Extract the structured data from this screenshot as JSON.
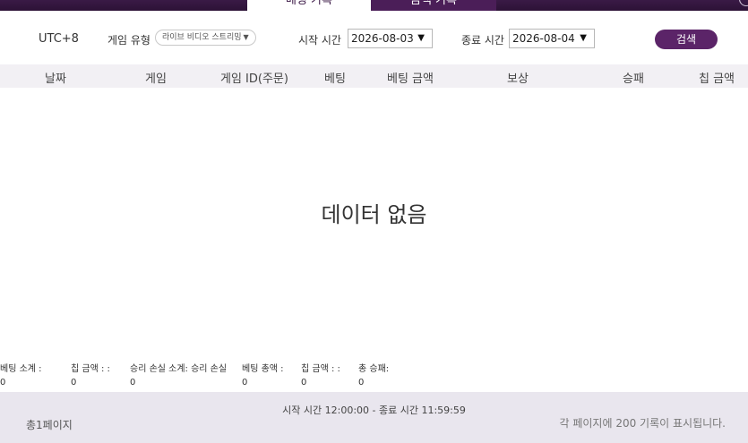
{
  "tabs": [
    {
      "label": "베팅 기록"
    },
    {
      "label": "금액 기록"
    }
  ],
  "filters": {
    "timezone": "UTC+8",
    "game_type_label": "게임 유형",
    "game_type_value": "라이브 비디오 스트리밍",
    "start_label": "시작 시간",
    "start_value": "2026-08-03",
    "end_label": "종료 시간",
    "end_value": "2026-08-04",
    "search_label": "검색"
  },
  "table": {
    "columns": [
      "날짜",
      "게임",
      "게임 ID(주문)",
      "베팅",
      "베팅 금액",
      "보상",
      "승패",
      "칩 금액"
    ],
    "empty_text": "데이터 없음"
  },
  "summary": [
    {
      "label": "베팅 소계 :",
      "value": "0"
    },
    {
      "label": "칩 금액 : :",
      "value": "0"
    },
    {
      "label": "승리 손실 소계: 승리 손실",
      "value": "0"
    },
    {
      "label": "베팅 총액 :",
      "value": "0"
    },
    {
      "label": "칩 금액 : :",
      "value": "0"
    },
    {
      "label": "총 승패:",
      "value": "0"
    }
  ],
  "footer": {
    "time_range": "시작 시간 12:00:00 - 종료 시간 11:59:59",
    "total_pages": "총1페이지",
    "per_page": "각 페이지에 200 기록이 표시됩니다."
  }
}
